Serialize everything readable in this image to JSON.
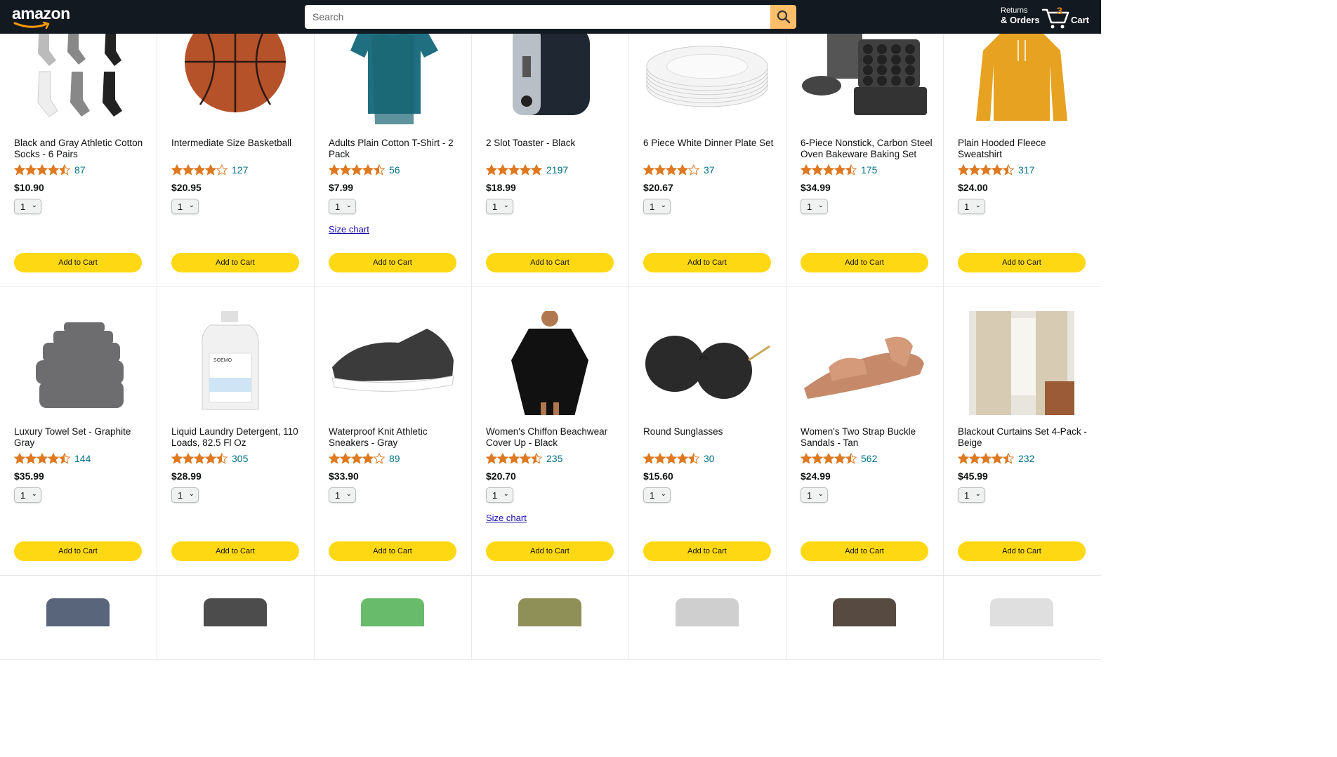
{
  "header": {
    "logo_text": "amazon",
    "search_placeholder": "Search",
    "returns_line1": "Returns",
    "returns_line2": "& Orders",
    "cart_count": "3",
    "cart_label": "Cart"
  },
  "products_row1": [
    {
      "name": "Black and Gray Athletic Cotton Socks - 6 Pairs",
      "stars": 4.5,
      "reviews": "87",
      "price": "$10.90",
      "qty": "1",
      "button": "Add to Cart",
      "image": "socks"
    },
    {
      "name": "Intermediate Size Basketball",
      "stars": 4,
      "reviews": "127",
      "price": "$20.95",
      "qty": "1",
      "button": "Add to Cart",
      "image": "basketball"
    },
    {
      "name": "Adults Plain Cotton T-Shirt - 2 Pack",
      "stars": 4.5,
      "reviews": "56",
      "price": "$7.99",
      "qty": "1",
      "button": "Add to Cart",
      "size_chart": "Size chart",
      "image": "tshirt"
    },
    {
      "name": "2 Slot Toaster - Black",
      "stars": 5,
      "reviews": "2197",
      "price": "$18.99",
      "qty": "1",
      "button": "Add to Cart",
      "image": "toaster"
    },
    {
      "name": "6 Piece White Dinner Plate Set",
      "stars": 4,
      "reviews": "37",
      "price": "$20.67",
      "qty": "1",
      "button": "Add to Cart",
      "image": "plates"
    },
    {
      "name": "6-Piece Nonstick, Carbon Steel Oven Bakeware Baking Set",
      "stars": 4.5,
      "reviews": "175",
      "price": "$34.99",
      "qty": "1",
      "button": "Add to Cart",
      "image": "bakeware"
    },
    {
      "name": "Plain Hooded Fleece Sweatshirt",
      "stars": 4.5,
      "reviews": "317",
      "price": "$24.00",
      "qty": "1",
      "button": "Add to Cart",
      "image": "hoodie"
    }
  ],
  "products_row2": [
    {
      "name": "Luxury Towel Set - Graphite Gray",
      "stars": 4.5,
      "reviews": "144",
      "price": "$35.99",
      "qty": "1",
      "button": "Add to Cart",
      "image": "towels"
    },
    {
      "name": "Liquid Laundry Detergent, 110 Loads, 82.5 Fl Oz",
      "stars": 4.5,
      "reviews": "305",
      "price": "$28.99",
      "qty": "1",
      "button": "Add to Cart",
      "image": "detergent",
      "image_brand_text": "SOEMO"
    },
    {
      "name": "Waterproof Knit Athletic Sneakers - Gray",
      "stars": 4,
      "reviews": "89",
      "price": "$33.90",
      "qty": "1",
      "button": "Add to Cart",
      "image": "sneakers"
    },
    {
      "name": "Women's Chiffon Beachwear Cover Up - Black",
      "stars": 4.5,
      "reviews": "235",
      "price": "$20.70",
      "qty": "1",
      "button": "Add to Cart",
      "size_chart": "Size chart",
      "image": "coverup"
    },
    {
      "name": "Round Sunglasses",
      "stars": 4.5,
      "reviews": "30",
      "price": "$15.60",
      "qty": "1",
      "button": "Add to Cart",
      "image": "sunglasses"
    },
    {
      "name": "Women's Two Strap Buckle Sandals - Tan",
      "stars": 4.5,
      "reviews": "562",
      "price": "$24.99",
      "qty": "1",
      "button": "Add to Cart",
      "image": "sandals"
    },
    {
      "name": "Blackout Curtains Set 4-Pack - Beige",
      "stars": 4.5,
      "reviews": "232",
      "price": "$45.99",
      "qty": "1",
      "button": "Add to Cart",
      "image": "curtains"
    }
  ],
  "colors": {
    "header_bg": "#131921",
    "search_button": "#febd69",
    "add_button": "#ffd814",
    "star": "#de7921",
    "review_link": "#007185",
    "cart_count": "#f08804"
  }
}
